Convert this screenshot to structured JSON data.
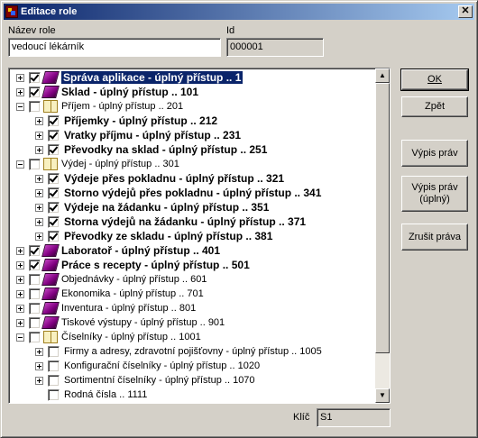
{
  "window": {
    "title": "Editace role",
    "close_glyph": "✕"
  },
  "fields": {
    "name_label": "Název role",
    "name_value": "vedoucí lékárník",
    "id_label": "Id",
    "id_value": "000001",
    "key_label": "Klíč",
    "key_value": "S1"
  },
  "buttons": {
    "ok": "OK",
    "back": "Zpět",
    "list_rights": "Výpis práv",
    "list_rights_full": "Výpis práv (úplný)",
    "cancel_rights": "Zrušit práva"
  },
  "scrollbar": {
    "up_glyph": "▲",
    "down_glyph": "▼"
  },
  "tree": {
    "rows": [
      {
        "label": "Správa aplikace - úplný přístup .. 1",
        "level": 0,
        "expander": "plus",
        "checked": true,
        "icon": "book-purple",
        "bold": true,
        "selected": true
      },
      {
        "label": "Sklad - úplný přístup .. 101",
        "level": 0,
        "expander": "plus",
        "checked": true,
        "icon": "book-purple",
        "bold": true
      },
      {
        "label": "Příjem - úplný přístup .. 201",
        "level": 0,
        "expander": "minus",
        "checked": false,
        "icon": "book-open",
        "bold": false
      },
      {
        "label": "Příjemky - úplný přístup .. 212",
        "level": 1,
        "expander": "plus",
        "checked": true,
        "icon": "none",
        "bold": true
      },
      {
        "label": "Vratky příjmu - úplný přístup .. 231",
        "level": 1,
        "expander": "plus",
        "checked": true,
        "icon": "none",
        "bold": true
      },
      {
        "label": "Převodky na sklad - úplný přístup .. 251",
        "level": 1,
        "expander": "plus",
        "checked": true,
        "icon": "none",
        "bold": true
      },
      {
        "label": "Výdej - úplný přístup .. 301",
        "level": 0,
        "expander": "minus",
        "checked": false,
        "icon": "book-open",
        "bold": false
      },
      {
        "label": "Výdeje přes pokladnu - úplný přístup .. 321",
        "level": 1,
        "expander": "plus",
        "checked": true,
        "icon": "none",
        "bold": true
      },
      {
        "label": "Storno výdejů přes pokladnu - úplný přístup .. 341",
        "level": 1,
        "expander": "plus",
        "checked": true,
        "icon": "none",
        "bold": true
      },
      {
        "label": "Výdeje na žádanku - úplný přístup .. 351",
        "level": 1,
        "expander": "plus",
        "checked": true,
        "icon": "none",
        "bold": true
      },
      {
        "label": "Storna výdejů na žádanku - úplný přístup .. 371",
        "level": 1,
        "expander": "plus",
        "checked": true,
        "icon": "none",
        "bold": true
      },
      {
        "label": "Převodky ze skladu - úplný přístup .. 381",
        "level": 1,
        "expander": "plus",
        "checked": true,
        "icon": "none",
        "bold": true
      },
      {
        "label": "Laboratoř - úplný přístup .. 401",
        "level": 0,
        "expander": "plus",
        "checked": true,
        "icon": "book-purple",
        "bold": true
      },
      {
        "label": "Práce s recepty - úplný přístup .. 501",
        "level": 0,
        "expander": "plus",
        "checked": true,
        "icon": "book-purple",
        "bold": true
      },
      {
        "label": "Objednávky - úplný přístup .. 601",
        "level": 0,
        "expander": "plus",
        "checked": false,
        "icon": "book-purple",
        "bold": false
      },
      {
        "label": "Ekonomika - úplný přístup .. 701",
        "level": 0,
        "expander": "plus",
        "checked": false,
        "icon": "book-purple",
        "bold": false
      },
      {
        "label": "Inventura - úplný přístup .. 801",
        "level": 0,
        "expander": "plus",
        "checked": false,
        "icon": "book-purple",
        "bold": false
      },
      {
        "label": "Tiskové výstupy - úplný přístup .. 901",
        "level": 0,
        "expander": "plus",
        "checked": false,
        "icon": "book-purple",
        "bold": false
      },
      {
        "label": "Číselníky - úplný přístup .. 1001",
        "level": 0,
        "expander": "minus",
        "checked": false,
        "icon": "book-open",
        "bold": false
      },
      {
        "label": "Firmy a adresy, zdravotní pojišťovny - úplný přístup .. 1005",
        "level": 1,
        "expander": "plus",
        "checked": false,
        "icon": "none",
        "bold": false
      },
      {
        "label": "Konfigurační číselníky - úplný přístup .. 1020",
        "level": 1,
        "expander": "plus",
        "checked": false,
        "icon": "none",
        "bold": false
      },
      {
        "label": "Sortimentní číselníky - úplný přístup .. 1070",
        "level": 1,
        "expander": "plus",
        "checked": false,
        "icon": "none",
        "bold": false
      },
      {
        "label": "Rodná čísla .. 1111",
        "level": 1,
        "expander": "none",
        "checked": false,
        "icon": "none",
        "bold": false
      }
    ]
  }
}
